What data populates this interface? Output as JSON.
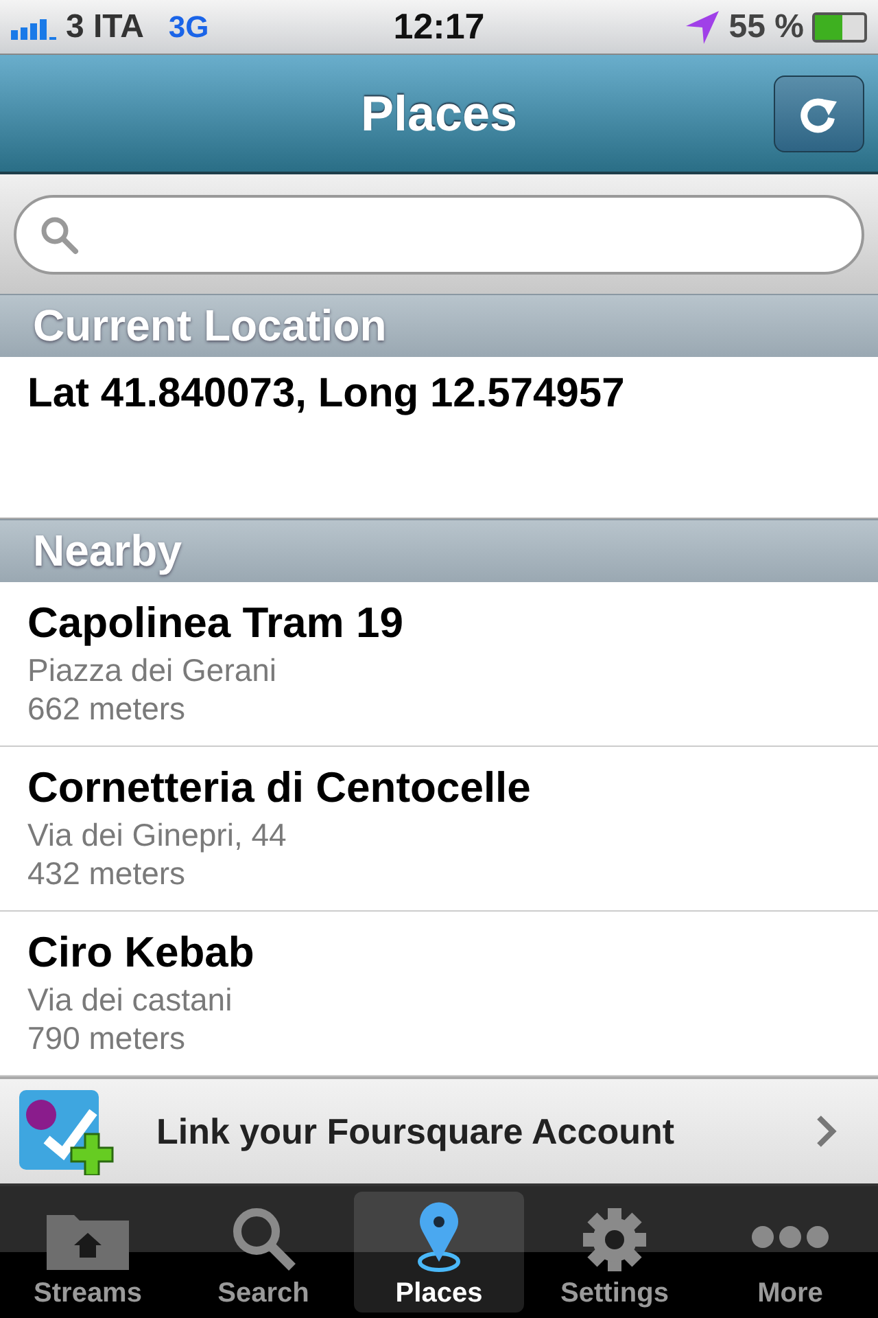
{
  "status_bar": {
    "carrier": "3 ITA",
    "network": "3G",
    "time": "12:17",
    "battery_text": "55 %"
  },
  "nav_bar": {
    "title": "Places"
  },
  "current_location": {
    "header": "Current Location",
    "text": "Lat 41.840073, Long 12.574957"
  },
  "nearby": {
    "header": "Nearby",
    "places": [
      {
        "name": "Capolinea Tram 19",
        "address": "Piazza dei Gerani",
        "distance": "662 meters"
      },
      {
        "name": "Cornetteria di Centocelle",
        "address": "Via dei Ginepri, 44",
        "distance": "432 meters"
      },
      {
        "name": "Ciro Kebab",
        "address": "Via dei castani",
        "distance": "790 meters"
      }
    ]
  },
  "banner": {
    "text": "Link your Foursquare Account"
  },
  "tab_bar": [
    {
      "kind": "streams",
      "label": "Streams",
      "selected": false
    },
    {
      "kind": "search",
      "label": "Search",
      "selected": false
    },
    {
      "kind": "places",
      "label": "Places",
      "selected": true
    },
    {
      "kind": "settings",
      "label": "Settings",
      "selected": false
    },
    {
      "kind": "more",
      "label": "More",
      "selected": false
    }
  ]
}
